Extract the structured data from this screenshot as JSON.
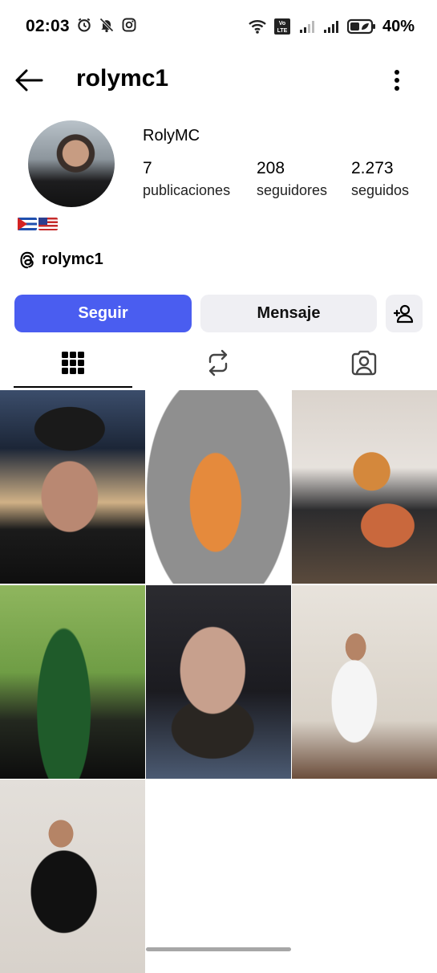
{
  "status_bar": {
    "time": "02:03",
    "battery_percent": "40%",
    "icons": [
      "alarm-icon",
      "mute-icon",
      "instagram-icon",
      "wifi-icon",
      "volte-icon",
      "signal-icon",
      "signal-icon",
      "battery-icon"
    ],
    "volte_label": "Vo LTE"
  },
  "nav": {
    "username": "rolymc1",
    "back_icon": "arrow-left-icon",
    "more_icon": "more-vertical-icon"
  },
  "profile": {
    "display_name": "RolyMC",
    "posts_count": "7",
    "posts_label": "publicaciones",
    "followers_count": "208",
    "followers_label": "seguidores",
    "following_count": "2.273",
    "following_label": "seguidos",
    "bio_flags": [
      "Cuba flag",
      "United States flag"
    ],
    "threads_handle": "rolymc1"
  },
  "actions": {
    "follow_label": "Seguir",
    "message_label": "Mensaje",
    "follow_color": "#4a5df0",
    "add_icon": "add-user-icon"
  },
  "tabs": [
    {
      "name": "grid",
      "icon": "grid-icon",
      "active": true
    },
    {
      "name": "reposts",
      "icon": "repost-icon",
      "active": false
    },
    {
      "name": "tagged",
      "icon": "tagged-icon",
      "active": false
    }
  ],
  "posts": [
    {
      "description": "selfie with cap in office"
    },
    {
      "description": "mirror selfie orange shirt"
    },
    {
      "description": "group dinner selfie"
    },
    {
      "description": "beer bottle and football on TV"
    },
    {
      "description": "close-up selfie"
    },
    {
      "description": "mirror selfie white shirt"
    },
    {
      "description": "mirror selfie black shirt"
    }
  ]
}
